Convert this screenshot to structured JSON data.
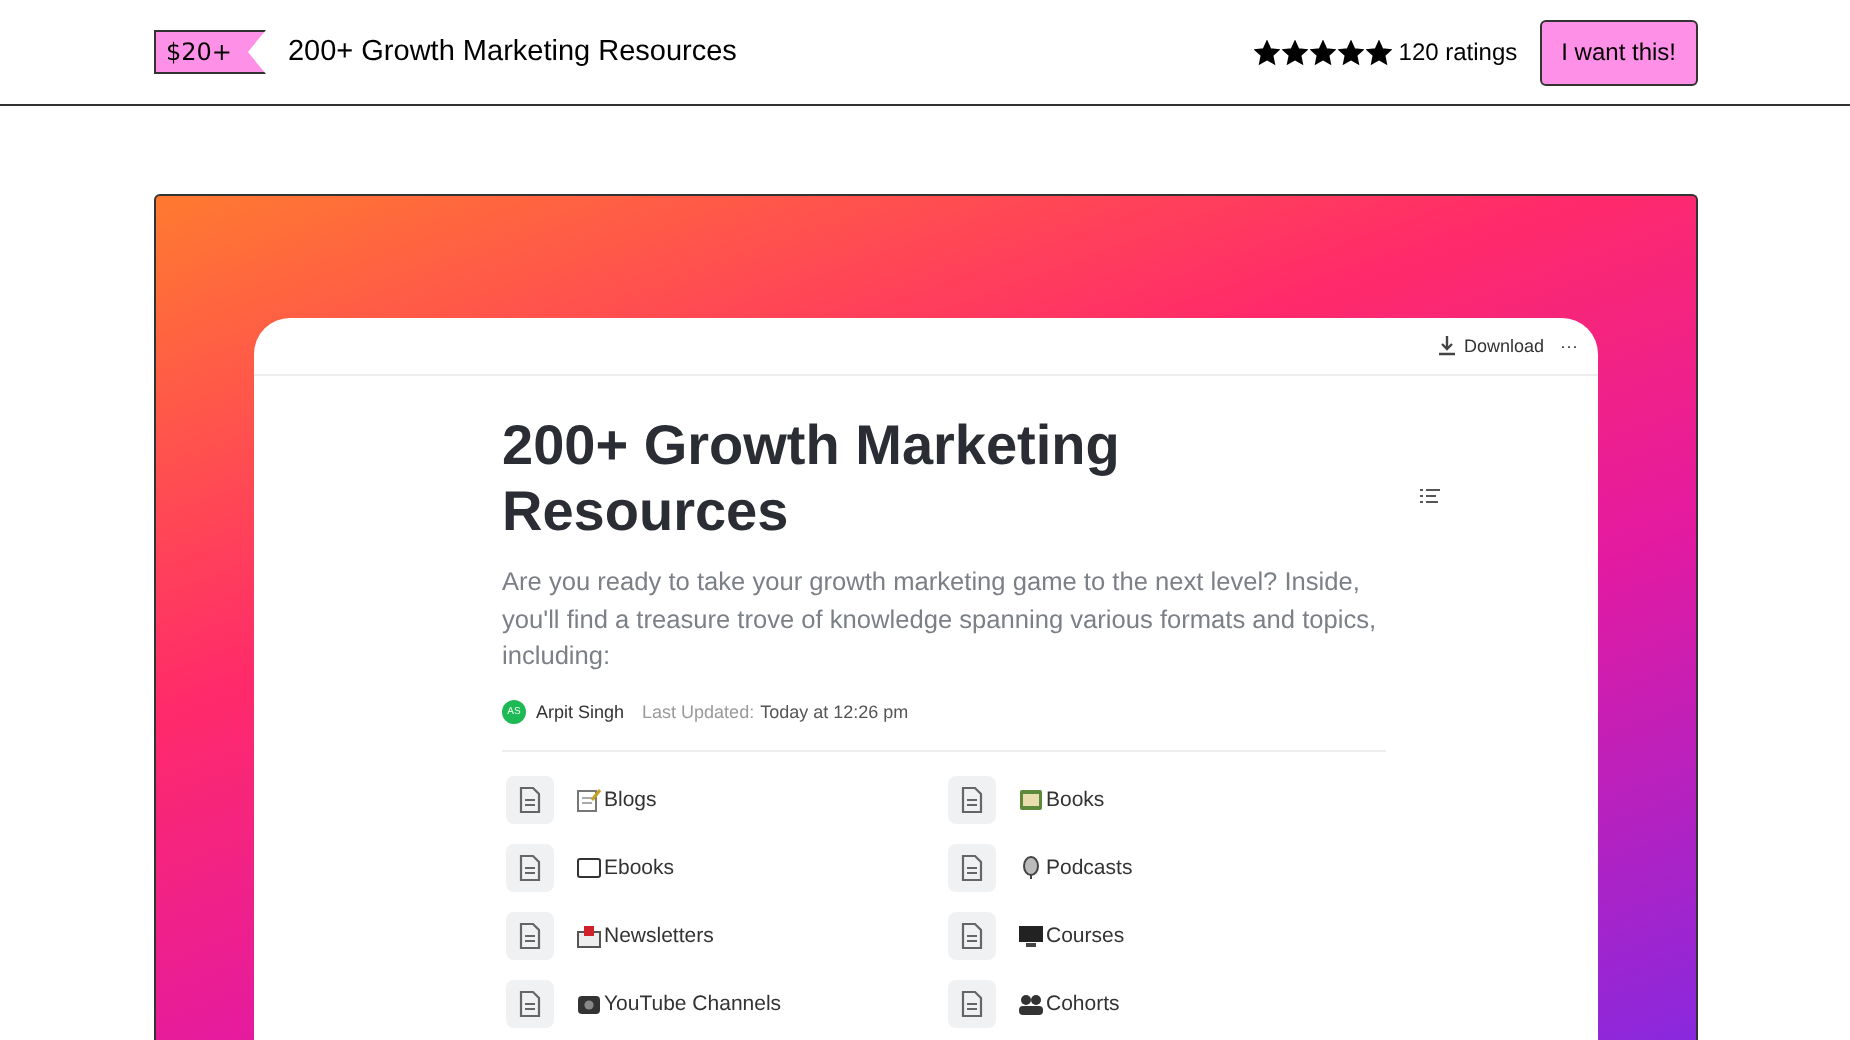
{
  "header": {
    "price": "$20+",
    "title": "200+ Growth Marketing Resources",
    "stars": 5,
    "ratings": "120 ratings",
    "buy_button": "I want this!"
  },
  "document": {
    "download": "Download",
    "more": "···",
    "title": "200+ Growth Marketing Resources",
    "description": "Are you ready to take your growth marketing game to the next level? Inside, you'll find a treasure trove of knowledge spanning various formats and topics, including:",
    "author_initials": "AS",
    "author": "Arpit Singh",
    "updated_label": "Last Updated:",
    "updated_value": "Today at 12:26 pm",
    "pages": [
      {
        "label": "Blogs"
      },
      {
        "label": "Books"
      },
      {
        "label": "Ebooks"
      },
      {
        "label": "Podcasts"
      },
      {
        "label": "Newsletters"
      },
      {
        "label": "Courses"
      },
      {
        "label": "YouTube Channels"
      },
      {
        "label": "Cohorts"
      }
    ]
  }
}
